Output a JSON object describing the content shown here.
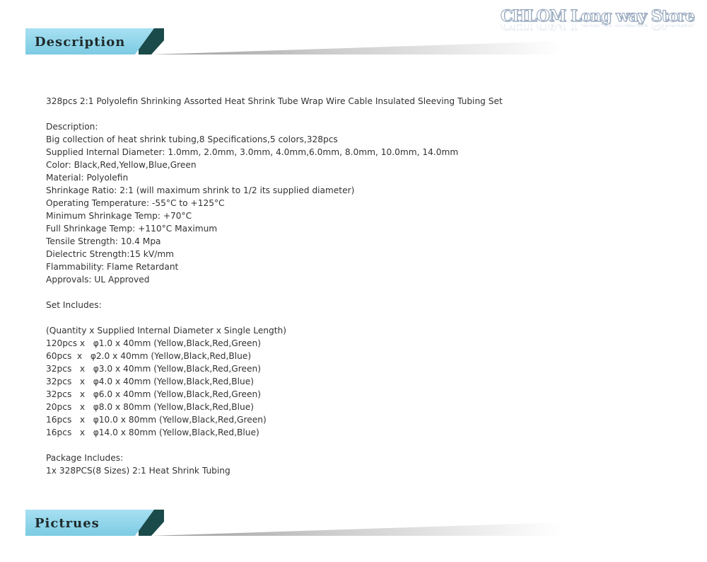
{
  "store": {
    "name": "CHLOM Long way Store"
  },
  "sections": {
    "description_title": "Description",
    "pictures_title": "Pictrues"
  },
  "content": {
    "product_title": "328pcs 2:1 Polyolefin Shrinking Assorted Heat Shrink Tube Wrap Wire Cable Insulated Sleeving Tubing Set",
    "description_heading": "Description:",
    "spec_lines": [
      "Big collection of heat shrink tubing,8 Specifications,5 colors,328pcs",
      "Supplied Internal Diameter: 1.0mm, 2.0mm, 3.0mm, 4.0mm,6.0mm, 8.0mm, 10.0mm, 14.0mm",
      "Color: Black,Red,Yellow,Blue,Green",
      "Material: Polyolefin",
      "Shrinkage Ratio: 2:1 (will maximum shrink to 1/2 its supplied diameter)",
      "Operating Temperature: -55°C to +125°C",
      "Minimum Shrinkage Temp: +70°C",
      "Full Shrinkage Temp: +110°C Maximum",
      "Tensile Strength: 10.4 Mpa",
      "Dielectric Strength:15 kV/mm",
      "Flammability: Flame Retardant",
      "Approvals: UL Approved"
    ],
    "set_heading": "Set Includes:",
    "set_legend": "(Quantity x Supplied Internal Diameter x Single Length)",
    "set_lines": [
      "120pcs x   φ1.0 x 40mm (Yellow,Black,Red,Green)",
      "60pcs  x   φ2.0 x 40mm (Yellow,Black,Red,Blue)",
      "32pcs   x   φ3.0 x 40mm (Yellow,Black,Red,Green)",
      "32pcs   x   φ4.0 x 40mm (Yellow,Black,Red,Blue)",
      "32pcs   x   φ6.0 x 40mm (Yellow,Black,Red,Green)",
      "20pcs   x   φ8.0 x 80mm (Yellow,Black,Red,Blue)",
      "16pcs   x   φ10.0 x 80mm (Yellow,Black,Red,Green)",
      "16pcs   x   φ14.0 x 80mm (Yellow,Black,Red,Blue)"
    ],
    "package_heading": "Package Includes:",
    "package_line": "1x 328PCS(8 Sizes) 2:1 Heat Shrink Tubing"
  },
  "colors": {
    "header_blue": "#8ed4ea",
    "header_dark_teal": "#1b4a4a",
    "header_gray": "#b7b7b7"
  }
}
